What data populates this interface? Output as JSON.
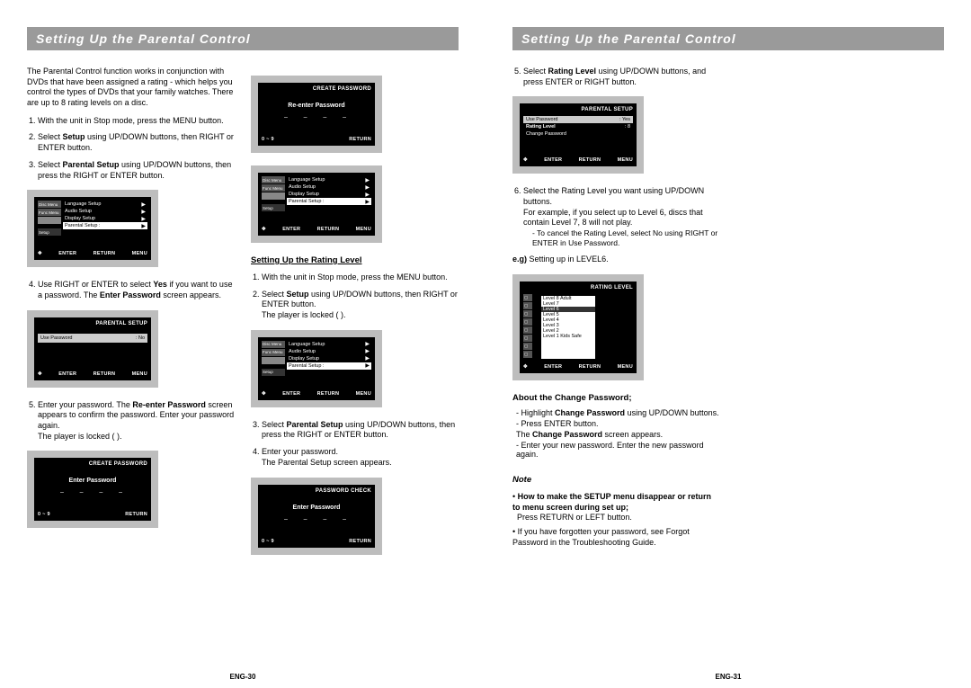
{
  "titles": {
    "left": "Setting Up the Parental Control",
    "right": "Setting Up the Parental Control"
  },
  "left": {
    "intro": "The Parental Control function works in conjunction with DVDs that have been assigned a rating - which helps you control the types of DVDs that your family watches. There are up to 8 rating levels on a disc.",
    "step1": "With the unit in Stop mode, press the MENU button.",
    "step2a": "Select ",
    "step2b": "Setup",
    "step2c": " using UP/DOWN buttons, then RIGHT or ENTER button.",
    "step3a": "Select ",
    "step3b": "Parental Setup",
    "step3c": " using UP/DOWN buttons, then press the RIGHT or ENTER button.",
    "step4a": "Use RIGHT or ENTER to select ",
    "step4b": "Yes",
    "step4c": " if you want to use a password. The ",
    "step4d": "Enter Password",
    "step4e": " screen appears.",
    "step5a": "Enter your password. The ",
    "step5b": "Re-enter Password",
    "step5c": " screen appears to confirm the password. Enter your password again.",
    "step5d": "The player is locked (   ).",
    "ratingHead": "Setting Up the Rating Level",
    "r1": "With the unit in Stop mode, press the MENU button.",
    "r2a": "Select ",
    "r2b": "Setup",
    "r2c": " using UP/DOWN buttons, then RIGHT or ENTER button.",
    "r2d": "The player is locked (   ).",
    "r3a": "Select ",
    "r3b": "Parental Setup",
    "r3c": " using UP/DOWN buttons, then press the RIGHT or ENTER button.",
    "r4a": "Enter your password.",
    "r4b": "The Parental Setup screen appears.",
    "createPassword": "CREATE PASSWORD",
    "reenterPassword": "Re-enter Password",
    "enterPassword": "Enter Password",
    "passwordCheck": "PASSWORD CHECK",
    "parentalSetup": "PARENTAL SETUP",
    "usePassword": "Use Password",
    "usePasswordNo": "No",
    "footRange": "0    ~    9",
    "footReturn": "RETURN",
    "footEnter": "ENTER",
    "footMenu": "MENU",
    "side": {
      "disc": "Disc Menu",
      "func": "Func Menu",
      "setup": "Setup"
    },
    "menu": {
      "lang": "Language Setup",
      "audio": "Audio Setup",
      "display": "Display Setup",
      "parental": "Parental Setup :"
    }
  },
  "right": {
    "step5a": "Select ",
    "step5b": "Rating Level",
    "step5c": " using UP/DOWN buttons, and press ENTER or RIGHT button.",
    "step6a": "Select the Rating Level  you want using UP/DOWN buttons.",
    "step6b": "For example, if you select up to Level 6, discs that contain Level 7, 8 will not play.",
    "step6c": "- To cancel the Rating Level, select No using RIGHT or ENTER in Use Password.",
    "eg": "e.g)",
    "egText": " Setting up in LEVEL6.",
    "aboutHead": "About the Change Password;",
    "about1a": "- Highlight ",
    "about1b": "Change Password",
    "about1c": " using UP/DOWN buttons.",
    "about2": "- Press ENTER button.",
    "about3a": "  The ",
    "about3b": "Change Password",
    "about3c": " screen appears.",
    "about4": "- Enter your new password. Enter the new password again.",
    "noteHead": "Note",
    "note1a": "• ",
    "note1b": "How to make the SETUP menu disappear or return to menu screen during set up;",
    "note1c": "Press RETURN or LEFT button.",
    "note2": "• If you have forgotten your password, see Forgot Password in the Troubleshooting Guide.",
    "ratingLevelTitle": "RATING LEVEL",
    "parentalSetup": "PARENTAL SETUP",
    "usePasswordYes": "Yes",
    "ratingLevelVal": "8",
    "changePassword": "Change Password",
    "levels": {
      "l8": "Level 8 Adult",
      "l7": "Level 7",
      "l6": "Level 6",
      "l5": "Level 5",
      "l4": "Level 4",
      "l3": "Level 3",
      "l2": "Level 2",
      "l1": "Level 1 Kids Safe"
    }
  },
  "pagenum": {
    "left": "ENG-30",
    "right": "ENG-31"
  }
}
